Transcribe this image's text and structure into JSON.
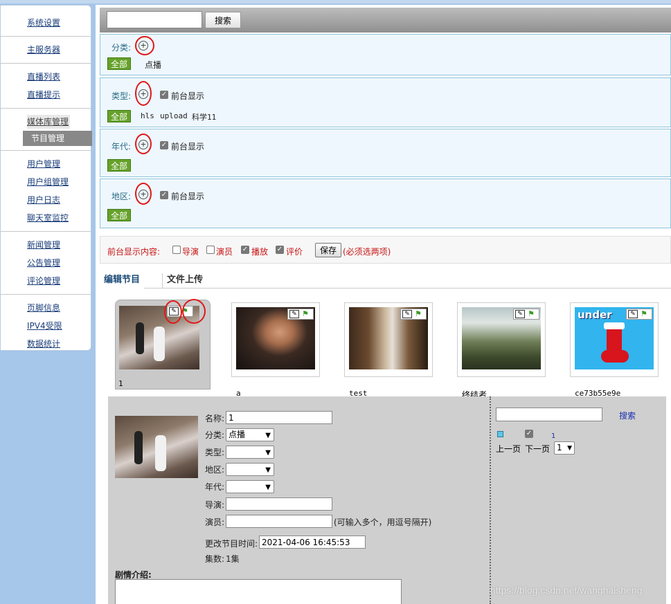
{
  "sidebar": {
    "groups": [
      [
        "系统设置"
      ],
      [
        "主服务器"
      ],
      [
        "直播列表",
        "直播提示"
      ],
      [
        "媒体库管理",
        "节目管理"
      ],
      [
        "用户管理",
        "用户组管理",
        "用户日志",
        "聊天室监控"
      ],
      [
        "新闻管理",
        "公告管理",
        "评论管理"
      ],
      [
        "页脚信息",
        "IPV4受限",
        "数据统计"
      ]
    ]
  },
  "search": {
    "value": "",
    "button": "搜索"
  },
  "filters": {
    "category": {
      "label": "分类:",
      "all": "全部",
      "items": [
        "点播"
      ]
    },
    "type": {
      "label": "类型:",
      "show": "前台显示",
      "all": "全部",
      "items": [
        "hls",
        "upload",
        "科学11"
      ]
    },
    "year": {
      "label": "年代:",
      "show": "前台显示",
      "all": "全部"
    },
    "region": {
      "label": "地区:",
      "show": "前台显示",
      "all": "全部"
    }
  },
  "display": {
    "label": "前台显示内容:",
    "options": [
      {
        "label": "导演",
        "checked": false
      },
      {
        "label": "演员",
        "checked": false
      },
      {
        "label": "播放",
        "checked": true
      },
      {
        "label": "评价",
        "checked": true
      }
    ],
    "save": "保存",
    "note": "(必须选两项)"
  },
  "tabs": [
    "编辑节目",
    "文件上传"
  ],
  "thumbnails": [
    {
      "title": "1",
      "selected": true
    },
    {
      "title": "a",
      "selected": false
    },
    {
      "title": "test",
      "selected": false
    },
    {
      "title": "终结者",
      "selected": false
    },
    {
      "title": "ce73b55e9e",
      "selected": false
    }
  ],
  "thumb_overlay_text": "under",
  "editor": {
    "name_label": "名称:",
    "name_value": "1",
    "category_label": "分类:",
    "category_value": "点播",
    "type_label": "类型:",
    "region_label": "地区:",
    "year_label": "年代:",
    "director_label": "导演:",
    "director_value": "",
    "actor_label": "演员:",
    "actor_value": "",
    "actor_hint": "(可输入多个，用逗号隔开)",
    "time_label": "更改节目时间:",
    "time_value": "2021-04-06 16:45:53",
    "episodes_label": "集数:",
    "episodes_value": "1集",
    "synopsis_label": "剧情介绍:"
  },
  "right_panel": {
    "search_value": "",
    "search_link": "搜索",
    "item_number": "1",
    "prev": "上一页",
    "next": "下一页",
    "page": "1"
  },
  "watermark": "https://blog.csdn.net/wanghaisheng",
  "colors": {
    "green_button": "#66a22a",
    "red_text": "#c81414",
    "teal_label": "#2a6c86",
    "link_blue": "#1a3d7a"
  }
}
